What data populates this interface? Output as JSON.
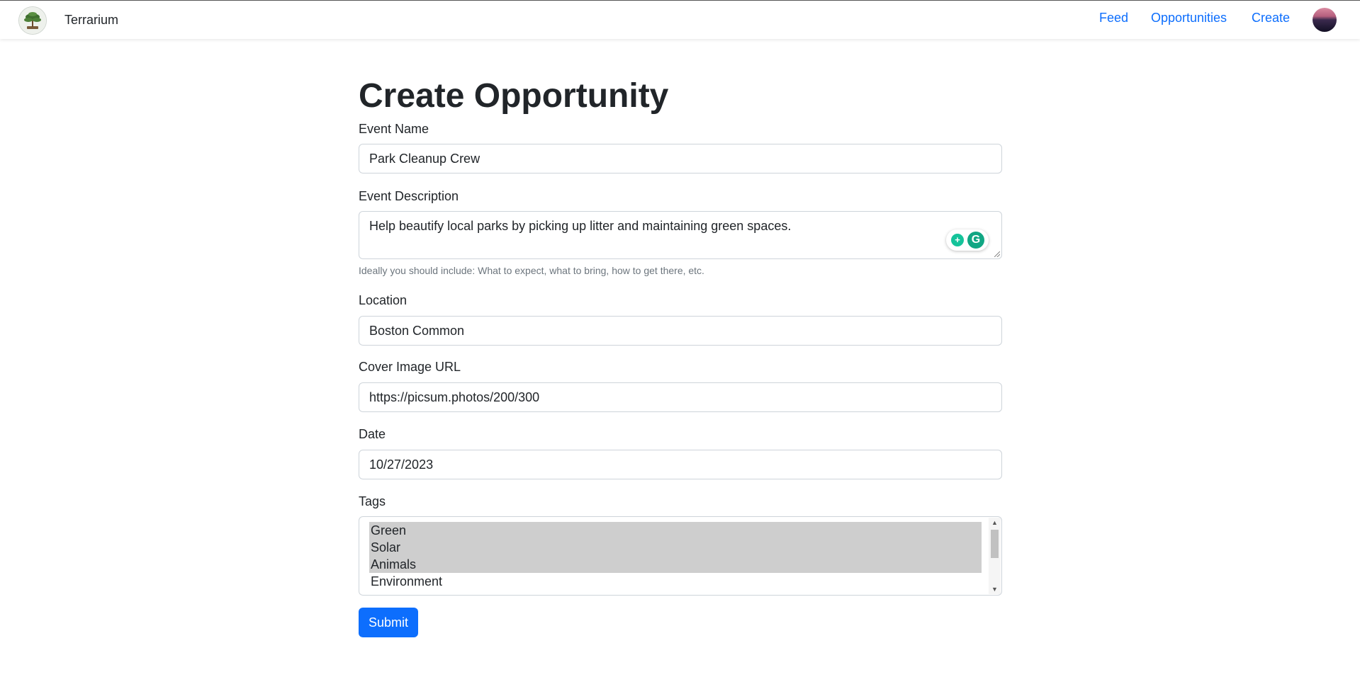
{
  "nav": {
    "brand": "Terrarium",
    "links": [
      "Feed",
      "Opportunities",
      "Create"
    ]
  },
  "form": {
    "title": "Create Opportunity",
    "event_name": {
      "label": "Event Name",
      "value": "Park Cleanup Crew"
    },
    "event_description": {
      "label": "Event Description",
      "value": "Help beautify local parks by picking up litter and maintaining green spaces.",
      "help": "Ideally you should include: What to expect, what to bring, how to get there, etc."
    },
    "location": {
      "label": "Location",
      "value": "Boston Common"
    },
    "cover_image": {
      "label": "Cover Image URL",
      "value": "https://picsum.photos/200/300"
    },
    "date": {
      "label": "Date",
      "value": "10/27/2023"
    },
    "tags": {
      "label": "Tags",
      "options": [
        {
          "label": "Green",
          "selected": true
        },
        {
          "label": "Solar",
          "selected": true
        },
        {
          "label": "Animals",
          "selected": true
        },
        {
          "label": "Environment",
          "selected": false
        }
      ]
    },
    "submit_label": "Submit"
  },
  "colors": {
    "accent": "#0d6efd",
    "selected_option": "#cecece",
    "grammarly": "#15c39a"
  },
  "icons": [
    "terrarium-logo-icon",
    "avatar-icon",
    "grammarly-suggestion-icon",
    "grammarly-icon",
    "scroll-up-icon",
    "scroll-down-icon"
  ]
}
